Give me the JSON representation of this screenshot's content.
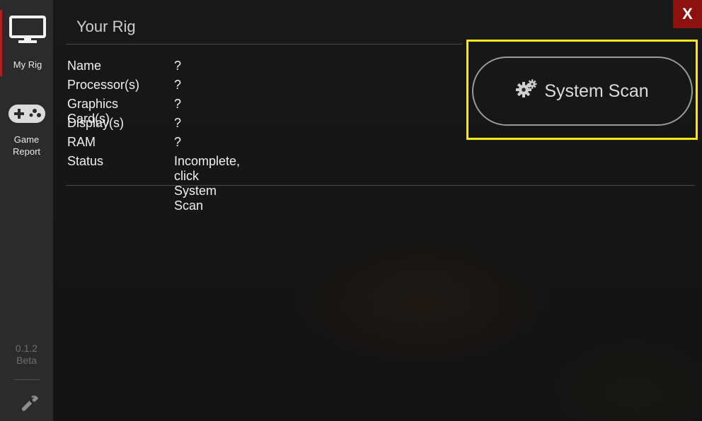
{
  "window": {
    "close_label": "X"
  },
  "sidebar": {
    "items": [
      {
        "label": "My Rig",
        "icon": "monitor-icon",
        "active": true
      },
      {
        "label": "Game Report",
        "icon": "gamepad-icon",
        "active": false
      }
    ],
    "version": "0.1.2",
    "version_tag": "Beta",
    "settings_icon": "wrench-icon"
  },
  "main": {
    "title": "Your Rig",
    "rig": [
      {
        "key": "Name",
        "value": "?"
      },
      {
        "key": "Processor(s)",
        "value": "?"
      },
      {
        "key": "Graphics Card(s)",
        "value": "?"
      },
      {
        "key": "Display(s)",
        "value": "?"
      },
      {
        "key": "RAM",
        "value": "?"
      },
      {
        "key": "Status",
        "value": "Incomplete, click System Scan"
      }
    ],
    "scan_button": {
      "label": "System Scan",
      "icon": "gears-icon"
    }
  },
  "colors": {
    "sidebar_bg": "#2b2b2b",
    "active_accent": "#b51e1e",
    "close_bg": "#8c1111",
    "highlight": "#f5ea16"
  }
}
